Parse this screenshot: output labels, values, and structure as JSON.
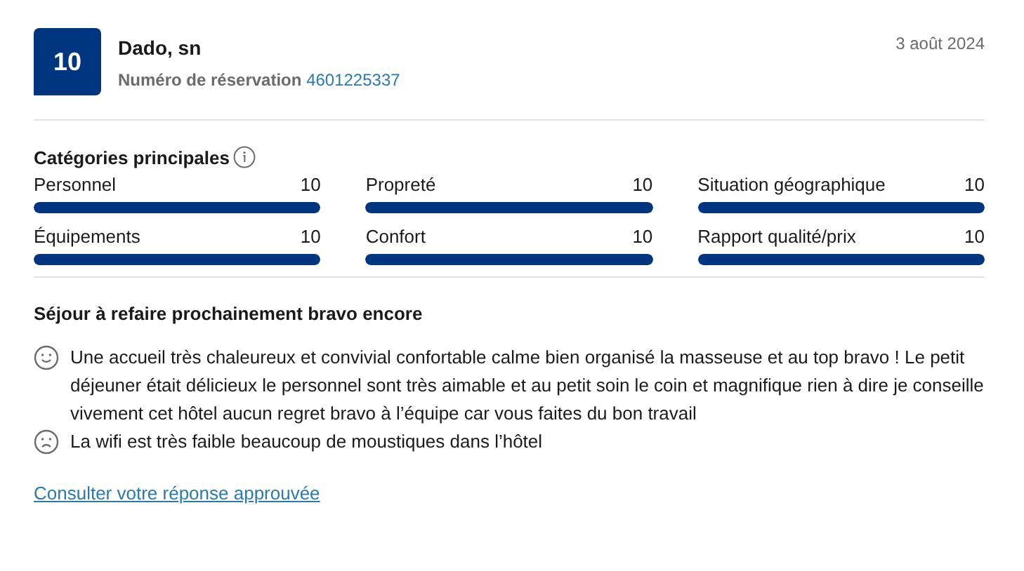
{
  "review": {
    "score": "10",
    "author": "Dado, sn",
    "booking_label": "Numéro de réservation",
    "booking_number": "4601225337",
    "date": "3 août 2024"
  },
  "categories": {
    "title": "Catégories principales",
    "items": [
      {
        "name": "Personnel",
        "value": "10",
        "level": 1
      },
      {
        "name": "Propreté",
        "value": "10",
        "level": 1
      },
      {
        "name": "Situation géographique",
        "value": "10",
        "level": 1
      },
      {
        "name": "Équipements",
        "value": "10",
        "level": 1
      },
      {
        "name": "Confort",
        "value": "10",
        "level": 1
      },
      {
        "name": "Rapport qualité/prix",
        "value": "10",
        "level": 1
      }
    ]
  },
  "headline": "Séjour à refaire prochainement bravo encore",
  "comments": [
    {
      "kind": "positive",
      "text": "Une accueil très chaleureux et convivial confortable calme bien organisé la masseuse et au top bravo ! Le petit déjeuner était délicieux le personnel sont très aimable et au petit soin le coin et magnifique rien à dire je conseille vivement cet hôtel aucun regret bravo à l’équipe car vous faites du bon travail"
    },
    {
      "kind": "negative",
      "text": "La wifi est très faible beaucoup de moustiques dans l’hôtel"
    }
  ],
  "link": "Consulter votre réponse approuvée"
}
